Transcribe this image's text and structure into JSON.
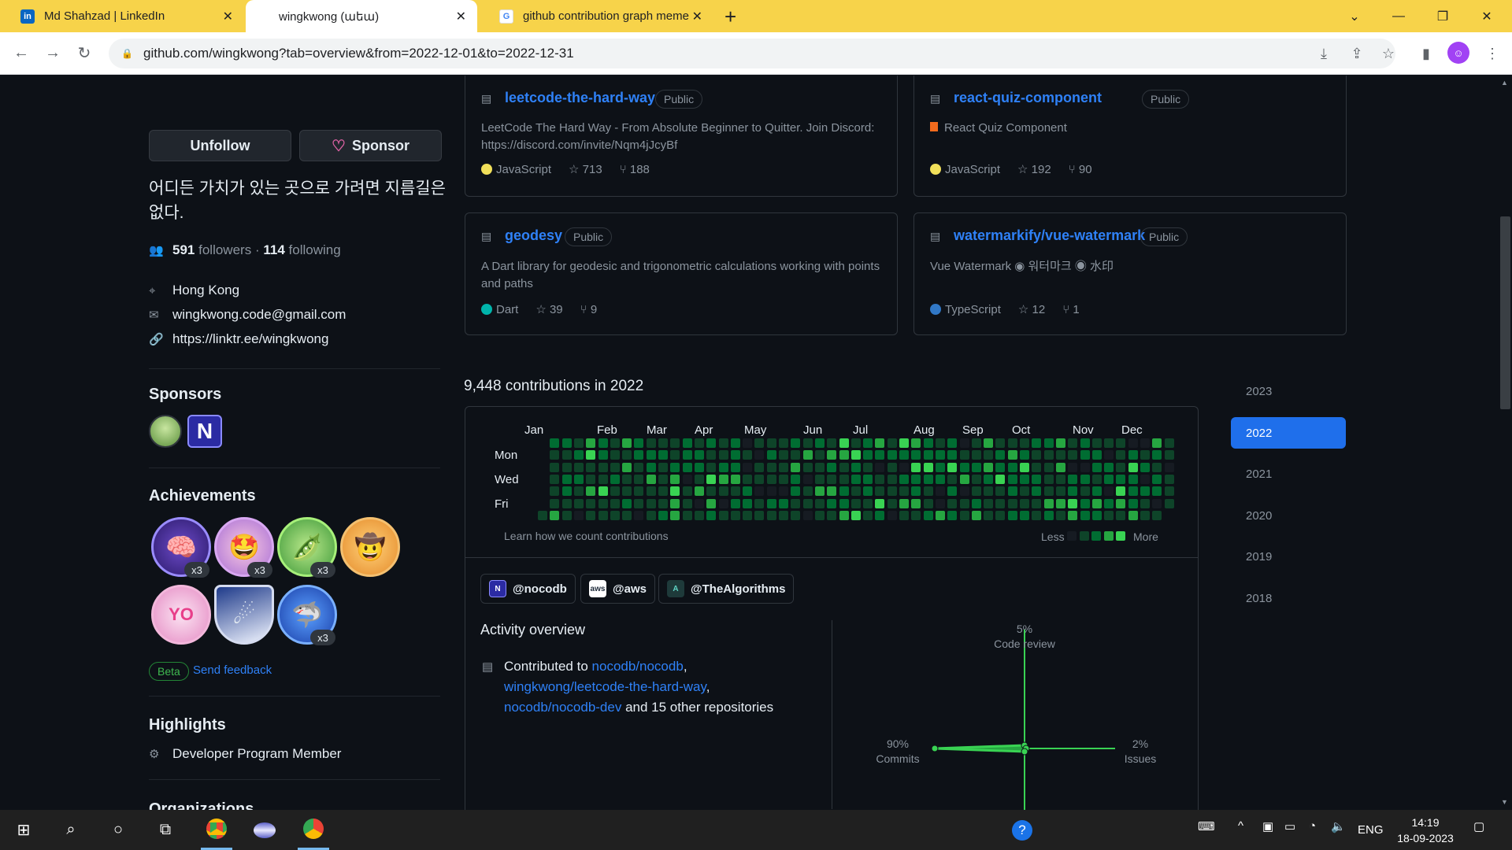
{
  "browser": {
    "tabs": [
      {
        "title": "Md Shahzad | LinkedIn",
        "icon": "linkedin-icon"
      },
      {
        "title": "wingkwong (աեա)",
        "icon": "github-icon"
      },
      {
        "title": "github contribution graph meme",
        "icon": "google-icon"
      }
    ],
    "url": "github.com/wingkwong?tab=overview&from=2022-12-01&to=2022-12-31"
  },
  "profile": {
    "unfollow_label": "Unfollow",
    "sponsor_label": "Sponsor",
    "bio": "어디든 가치가 있는 곳으로 가려면 지름길은 없다.",
    "followers": "591",
    "followers_label": "followers",
    "sep": "·",
    "following": "114",
    "following_label": "following",
    "location": "Hong Kong",
    "email": "wingkwong.code@gmail.com",
    "link": "https://linktr.ee/wingkwong",
    "sponsors_title": "Sponsors",
    "achievements_title": "Achievements",
    "achievement_counts": [
      "x3",
      "x3",
      "x3",
      "x3"
    ],
    "beta_label": "Beta",
    "feedback_label": "Send feedback",
    "highlights_title": "Highlights",
    "highlight_item": "Developer Program Member",
    "organizations_title": "Organizations"
  },
  "pinned": [
    {
      "name": "leetcode-the-hard-way",
      "visibility": "Public",
      "description": "LeetCode The Hard Way - From Absolute Beginner to Quitter. Join Discord: https://discord.com/invite/Nqm4jJcyBf",
      "language": "JavaScript",
      "lang_color": "#f1e05a",
      "stars": "713",
      "forks": "188"
    },
    {
      "name": "react-quiz-component",
      "visibility": "Public",
      "description": "React Quiz Component",
      "language": "JavaScript",
      "lang_color": "#f1e05a",
      "stars": "192",
      "forks": "90"
    },
    {
      "name": "geodesy",
      "visibility": "Public",
      "description": "A Dart library for geodesic and trigonometric calculations working with points and paths",
      "language": "Dart",
      "lang_color": "#00B4AB",
      "stars": "39",
      "forks": "9"
    },
    {
      "name": "watermarkify/vue-watermark",
      "visibility": "Public",
      "description": "Vue Watermark ◉ 워터마크 ◉ 水印",
      "language": "TypeScript",
      "lang_color": "#3178c6",
      "stars": "12",
      "forks": "1"
    }
  ],
  "contributions": {
    "heading": "9,448 contributions in 2022",
    "months": [
      "Jan",
      "Feb",
      "Mar",
      "Apr",
      "May",
      "Jun",
      "Jul",
      "Aug",
      "Sep",
      "Oct",
      "Nov",
      "Dec"
    ],
    "days": [
      "Mon",
      "Wed",
      "Fri"
    ],
    "learn_label": "Learn how we count contributions",
    "less_label": "Less",
    "more_label": "More",
    "palette": [
      "#161b22",
      "#0e4429",
      "#006d32",
      "#26a641",
      "#39d353"
    ]
  },
  "years": [
    "2023",
    "2022",
    "2021",
    "2020",
    "2019",
    "2018"
  ],
  "active_year": "2022",
  "orgs": [
    {
      "name": "@nocodb",
      "icon": "N"
    },
    {
      "name": "@aws",
      "icon": "aws"
    },
    {
      "name": "@TheAlgorithms",
      "icon": "A"
    }
  ],
  "activity": {
    "title": "Activity overview",
    "contributed_to": "Contributed to",
    "repo1": "nocodb/nocodb",
    "repo2": "wingkwong/leetcode-the-hard-way",
    "repo3": "nocodb/nocodb-dev",
    "rest": "and 15 other repositories",
    "code_review_pct": "5%",
    "code_review_label": "Code review",
    "commits_pct": "90%",
    "commits_label": "Commits",
    "issues_pct": "2%",
    "issues_label": "Issues"
  },
  "taskbar": {
    "lang": "ENG",
    "time": "14:19",
    "date": "18-09-2023"
  }
}
